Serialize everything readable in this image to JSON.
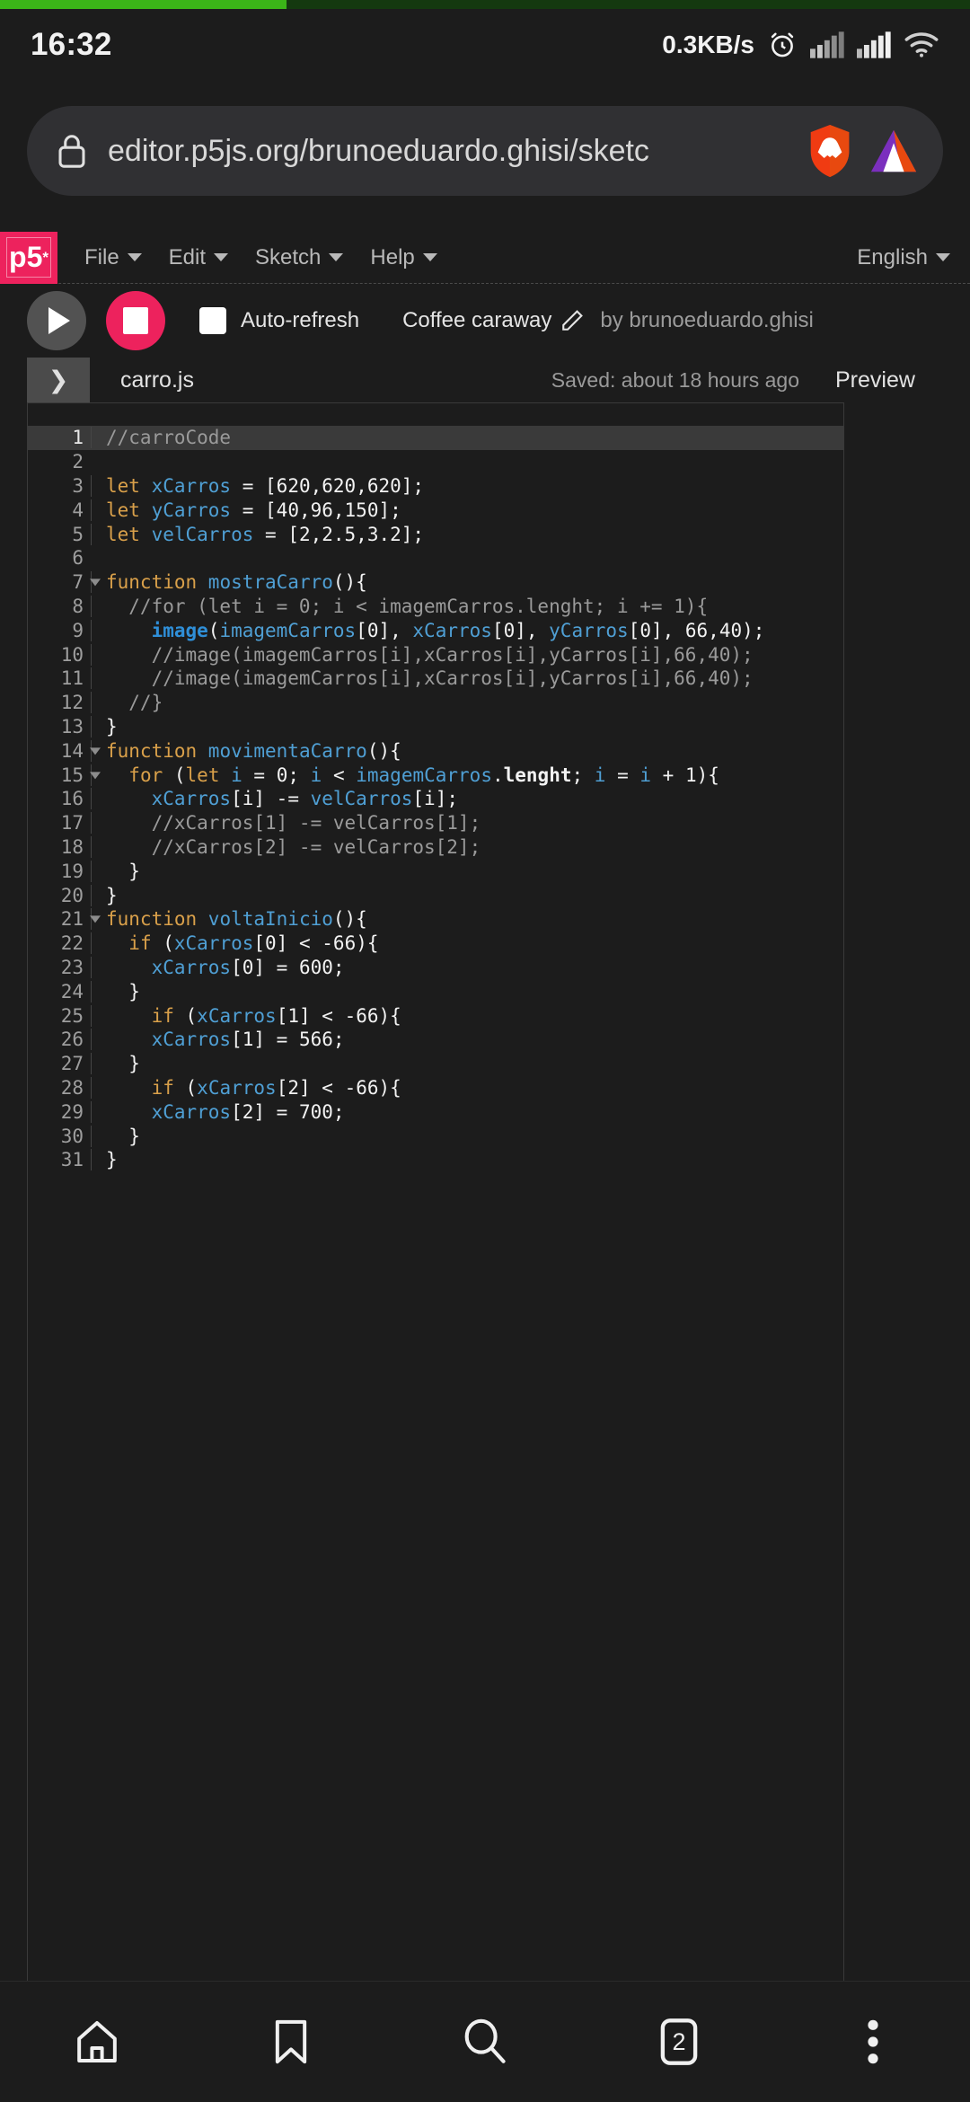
{
  "status_bar": {
    "clock": "16:32",
    "net_speed": "0.3KB/s",
    "icons": [
      "alarm-clock-icon",
      "signal-icon",
      "signal-icon",
      "wifi-icon"
    ]
  },
  "browser": {
    "url": "editor.p5js.org/brunoeduardo.ghisi/sketc",
    "lock_icon": "lock-icon",
    "brave_icon": "brave-lion-icon",
    "bat_icon": "bat-triangle-icon",
    "progress_percent": 29.5,
    "progress_color": "#3bb518",
    "bottom_nav": {
      "home": "home-icon",
      "bookmarks": "bookmark-icon",
      "search": "search-icon",
      "tabs_count": "2",
      "menu": "three-dot-menu-icon"
    }
  },
  "p5": {
    "logo": "p5",
    "logo_star": "*",
    "logo_color": "#ed225d",
    "menus": [
      {
        "label": "File"
      },
      {
        "label": "Edit"
      },
      {
        "label": "Sketch"
      },
      {
        "label": "Help"
      }
    ],
    "language": "English",
    "toolbar": {
      "play_icon": "play-icon",
      "stop_icon": "stop-icon",
      "autorefresh_label": "Auto-refresh",
      "autorefresh_checked": false,
      "sketch_name": "Coffee caraway",
      "edit_icon": "pencil-icon",
      "author": "by brunoeduardo.ghisi"
    },
    "file_strip": {
      "toggle_icon": "❯",
      "file_name": "carro.js",
      "saved_status": "Saved: about 18 hours ago",
      "preview_label": "Preview"
    }
  },
  "code": {
    "active_line": 1,
    "lines": [
      {
        "n": "1",
        "fold": false,
        "tokens": [
          {
            "t": "//carroCode",
            "c": "cm"
          }
        ]
      },
      {
        "n": "2",
        "fold": false,
        "tokens": []
      },
      {
        "n": "3",
        "fold": false,
        "tokens": [
          {
            "t": "let ",
            "c": "kw"
          },
          {
            "t": "xCarros",
            "c": "var"
          },
          {
            "t": " = ",
            "c": "pl"
          },
          {
            "t": "[620,620,620];",
            "c": "num"
          }
        ]
      },
      {
        "n": "4",
        "fold": false,
        "tokens": [
          {
            "t": "let ",
            "c": "kw"
          },
          {
            "t": "yCarros",
            "c": "var"
          },
          {
            "t": " = ",
            "c": "pl"
          },
          {
            "t": "[40,96,150];",
            "c": "num"
          }
        ]
      },
      {
        "n": "5",
        "fold": false,
        "tokens": [
          {
            "t": "let ",
            "c": "kw"
          },
          {
            "t": "velCarros",
            "c": "var"
          },
          {
            "t": " = ",
            "c": "pl"
          },
          {
            "t": "[2,2.5,3.2];",
            "c": "num"
          }
        ]
      },
      {
        "n": "6",
        "fold": false,
        "tokens": []
      },
      {
        "n": "7",
        "fold": true,
        "tokens": [
          {
            "t": "function ",
            "c": "kw"
          },
          {
            "t": "mostraCarro",
            "c": "var"
          },
          {
            "t": "(){",
            "c": "pl"
          }
        ]
      },
      {
        "n": "8",
        "fold": false,
        "tokens": [
          {
            "t": "  //for (let i = 0; i < imagemCarros.lenght; i += 1){",
            "c": "cm"
          }
        ]
      },
      {
        "n": "9",
        "fold": false,
        "tokens": [
          {
            "t": "    ",
            "c": "pl"
          },
          {
            "t": "image",
            "c": "fn"
          },
          {
            "t": "(",
            "c": "pl"
          },
          {
            "t": "imagemCarros",
            "c": "var"
          },
          {
            "t": "[0]",
            "c": "num"
          },
          {
            "t": ", ",
            "c": "pl"
          },
          {
            "t": "xCarros",
            "c": "var"
          },
          {
            "t": "[0]",
            "c": "num"
          },
          {
            "t": ", ",
            "c": "pl"
          },
          {
            "t": "yCarros",
            "c": "var"
          },
          {
            "t": "[0]",
            "c": "num"
          },
          {
            "t": ", 66,40);",
            "c": "num"
          }
        ]
      },
      {
        "n": "10",
        "fold": false,
        "tokens": [
          {
            "t": "    //image(imagemCarros[i],xCarros[i],yCarros[i],66,40);",
            "c": "cm"
          }
        ]
      },
      {
        "n": "11",
        "fold": false,
        "tokens": [
          {
            "t": "    //image(imagemCarros[i],xCarros[i],yCarros[i],66,40);",
            "c": "cm"
          }
        ]
      },
      {
        "n": "12",
        "fold": false,
        "tokens": [
          {
            "t": "  //}",
            "c": "cm"
          }
        ]
      },
      {
        "n": "13",
        "fold": false,
        "tokens": [
          {
            "t": "}",
            "c": "pl"
          }
        ]
      },
      {
        "n": "14",
        "fold": true,
        "tokens": [
          {
            "t": "function ",
            "c": "kw"
          },
          {
            "t": "movimentaCarro",
            "c": "var"
          },
          {
            "t": "(){",
            "c": "pl"
          }
        ]
      },
      {
        "n": "15",
        "fold": true,
        "tokens": [
          {
            "t": "  ",
            "c": "pl"
          },
          {
            "t": "for ",
            "c": "kw"
          },
          {
            "t": "(",
            "c": "pl"
          },
          {
            "t": "let ",
            "c": "kw"
          },
          {
            "t": "i",
            "c": "var"
          },
          {
            "t": " = ",
            "c": "pl"
          },
          {
            "t": "0",
            "c": "num"
          },
          {
            "t": "; ",
            "c": "pl"
          },
          {
            "t": "i",
            "c": "var"
          },
          {
            "t": " < ",
            "c": "pl"
          },
          {
            "t": "imagemCarros",
            "c": "var"
          },
          {
            "t": ".",
            "c": "pl"
          },
          {
            "t": "lenght",
            "c": "bld"
          },
          {
            "t": "; ",
            "c": "pl"
          },
          {
            "t": "i",
            "c": "var"
          },
          {
            "t": " = ",
            "c": "pl"
          },
          {
            "t": "i",
            "c": "var"
          },
          {
            "t": " + ",
            "c": "pl"
          },
          {
            "t": "1",
            "c": "num"
          },
          {
            "t": "){",
            "c": "pl"
          }
        ]
      },
      {
        "n": "16",
        "fold": false,
        "tokens": [
          {
            "t": "    ",
            "c": "pl"
          },
          {
            "t": "xCarros",
            "c": "var"
          },
          {
            "t": "[i] ",
            "c": "num"
          },
          {
            "t": "-= ",
            "c": "pl"
          },
          {
            "t": "velCarros",
            "c": "var"
          },
          {
            "t": "[i];",
            "c": "num"
          }
        ]
      },
      {
        "n": "17",
        "fold": false,
        "tokens": [
          {
            "t": "    //xCarros[1] -= velCarros[1];",
            "c": "cm"
          }
        ]
      },
      {
        "n": "18",
        "fold": false,
        "tokens": [
          {
            "t": "    //xCarros[2] -= velCarros[2];",
            "c": "cm"
          }
        ]
      },
      {
        "n": "19",
        "fold": false,
        "tokens": [
          {
            "t": "  }",
            "c": "pl"
          }
        ]
      },
      {
        "n": "20",
        "fold": false,
        "tokens": [
          {
            "t": "}",
            "c": "pl"
          }
        ]
      },
      {
        "n": "21",
        "fold": true,
        "tokens": [
          {
            "t": "function ",
            "c": "kw"
          },
          {
            "t": "voltaInicio",
            "c": "var"
          },
          {
            "t": "(){",
            "c": "pl"
          }
        ]
      },
      {
        "n": "22",
        "fold": false,
        "tokens": [
          {
            "t": "  ",
            "c": "pl"
          },
          {
            "t": "if ",
            "c": "kw"
          },
          {
            "t": "(",
            "c": "pl"
          },
          {
            "t": "xCarros",
            "c": "var"
          },
          {
            "t": "[0]",
            "c": "num"
          },
          {
            "t": " < ",
            "c": "pl"
          },
          {
            "t": "-66",
            "c": "num"
          },
          {
            "t": "){",
            "c": "pl"
          }
        ]
      },
      {
        "n": "23",
        "fold": false,
        "tokens": [
          {
            "t": "    ",
            "c": "pl"
          },
          {
            "t": "xCarros",
            "c": "var"
          },
          {
            "t": "[0]",
            "c": "num"
          },
          {
            "t": " = ",
            "c": "pl"
          },
          {
            "t": "600;",
            "c": "num"
          }
        ]
      },
      {
        "n": "24",
        "fold": false,
        "tokens": [
          {
            "t": "  }",
            "c": "pl"
          }
        ]
      },
      {
        "n": "25",
        "fold": false,
        "tokens": [
          {
            "t": "    ",
            "c": "pl"
          },
          {
            "t": "if ",
            "c": "kw"
          },
          {
            "t": "(",
            "c": "pl"
          },
          {
            "t": "xCarros",
            "c": "var"
          },
          {
            "t": "[1]",
            "c": "num"
          },
          {
            "t": " < ",
            "c": "pl"
          },
          {
            "t": "-66",
            "c": "num"
          },
          {
            "t": "){",
            "c": "pl"
          }
        ]
      },
      {
        "n": "26",
        "fold": false,
        "tokens": [
          {
            "t": "    ",
            "c": "pl"
          },
          {
            "t": "xCarros",
            "c": "var"
          },
          {
            "t": "[1]",
            "c": "num"
          },
          {
            "t": " = ",
            "c": "pl"
          },
          {
            "t": "566;",
            "c": "num"
          }
        ]
      },
      {
        "n": "27",
        "fold": false,
        "tokens": [
          {
            "t": "  }",
            "c": "pl"
          }
        ]
      },
      {
        "n": "28",
        "fold": false,
        "tokens": [
          {
            "t": "    ",
            "c": "pl"
          },
          {
            "t": "if ",
            "c": "kw"
          },
          {
            "t": "(",
            "c": "pl"
          },
          {
            "t": "xCarros",
            "c": "var"
          },
          {
            "t": "[2]",
            "c": "num"
          },
          {
            "t": " < ",
            "c": "pl"
          },
          {
            "t": "-66",
            "c": "num"
          },
          {
            "t": "){",
            "c": "pl"
          }
        ]
      },
      {
        "n": "29",
        "fold": false,
        "tokens": [
          {
            "t": "    ",
            "c": "pl"
          },
          {
            "t": "xCarros",
            "c": "var"
          },
          {
            "t": "[2]",
            "c": "num"
          },
          {
            "t": " = ",
            "c": "pl"
          },
          {
            "t": "700;",
            "c": "num"
          }
        ]
      },
      {
        "n": "30",
        "fold": false,
        "tokens": [
          {
            "t": "  }",
            "c": "pl"
          }
        ]
      },
      {
        "n": "31",
        "fold": false,
        "tokens": [
          {
            "t": "}",
            "c": "pl"
          }
        ]
      }
    ]
  }
}
